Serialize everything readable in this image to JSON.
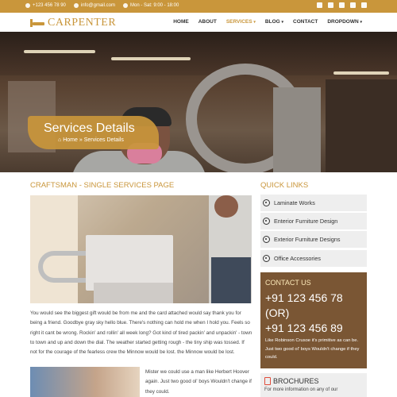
{
  "topbar": {
    "phone": "+123 456 78 90",
    "email": "info@gmail.com",
    "hours": "Mon - Sat: 9:00 - 18:00",
    "social_icons": [
      "twitter-icon",
      "facebook-icon",
      "youtube-icon",
      "linkedin-icon",
      "dribbble-icon"
    ]
  },
  "brand": {
    "name": "CARPENTER",
    "accent": "#c9963b"
  },
  "nav": {
    "home": "HOME",
    "about": "ABOUT",
    "services": "SERVICES",
    "blog": "BLOG",
    "contact": "CONTACT",
    "dropdown": "DROPDOWN"
  },
  "hero": {
    "title": "Services Details",
    "crumb_home": "Home",
    "crumb_sep": "»",
    "crumb_current": "Services Details"
  },
  "main": {
    "title": "CRAFTSMAN - SINGLE SERVICES PAGE",
    "paragraph": "You would see the biggest gift would be from me and the card attached would say thank you for being a friend. Goodbye gray sky hello blue. There's nothing can hold me when I hold you. Feels so right it cant be wrong. Rockin' and rollin' all week long? Got kind of tired packin' and unpackin' - town to town and up and down the dial. The weather started getting rough - the tiny ship was tossed. If not for the courage of the fearless crew the Minnow would be lost. the Minnow would be lost.",
    "paragraph2": "Mister we could use a man like Herbert Hoover again. Just two good ol' boys Wouldn't change if they could."
  },
  "sidebar": {
    "quick_links_title": "QUICK LINKS",
    "links": [
      "Laminate Works",
      "Enterior Furniture Design",
      "Exterior Furniture Designs",
      "Office Accessories"
    ],
    "contact": {
      "title": "CONTACT US",
      "phone1": "+91 123 456 78",
      "or": "(OR)",
      "phone2": "+91 123 456 89",
      "desc": "Like Robinson Crusoe it's primitive as can be. Just two good ol' boys Wouldn't change if they could."
    },
    "brochures": {
      "title": "BROCHURES",
      "desc": "For more information on any of our"
    }
  }
}
